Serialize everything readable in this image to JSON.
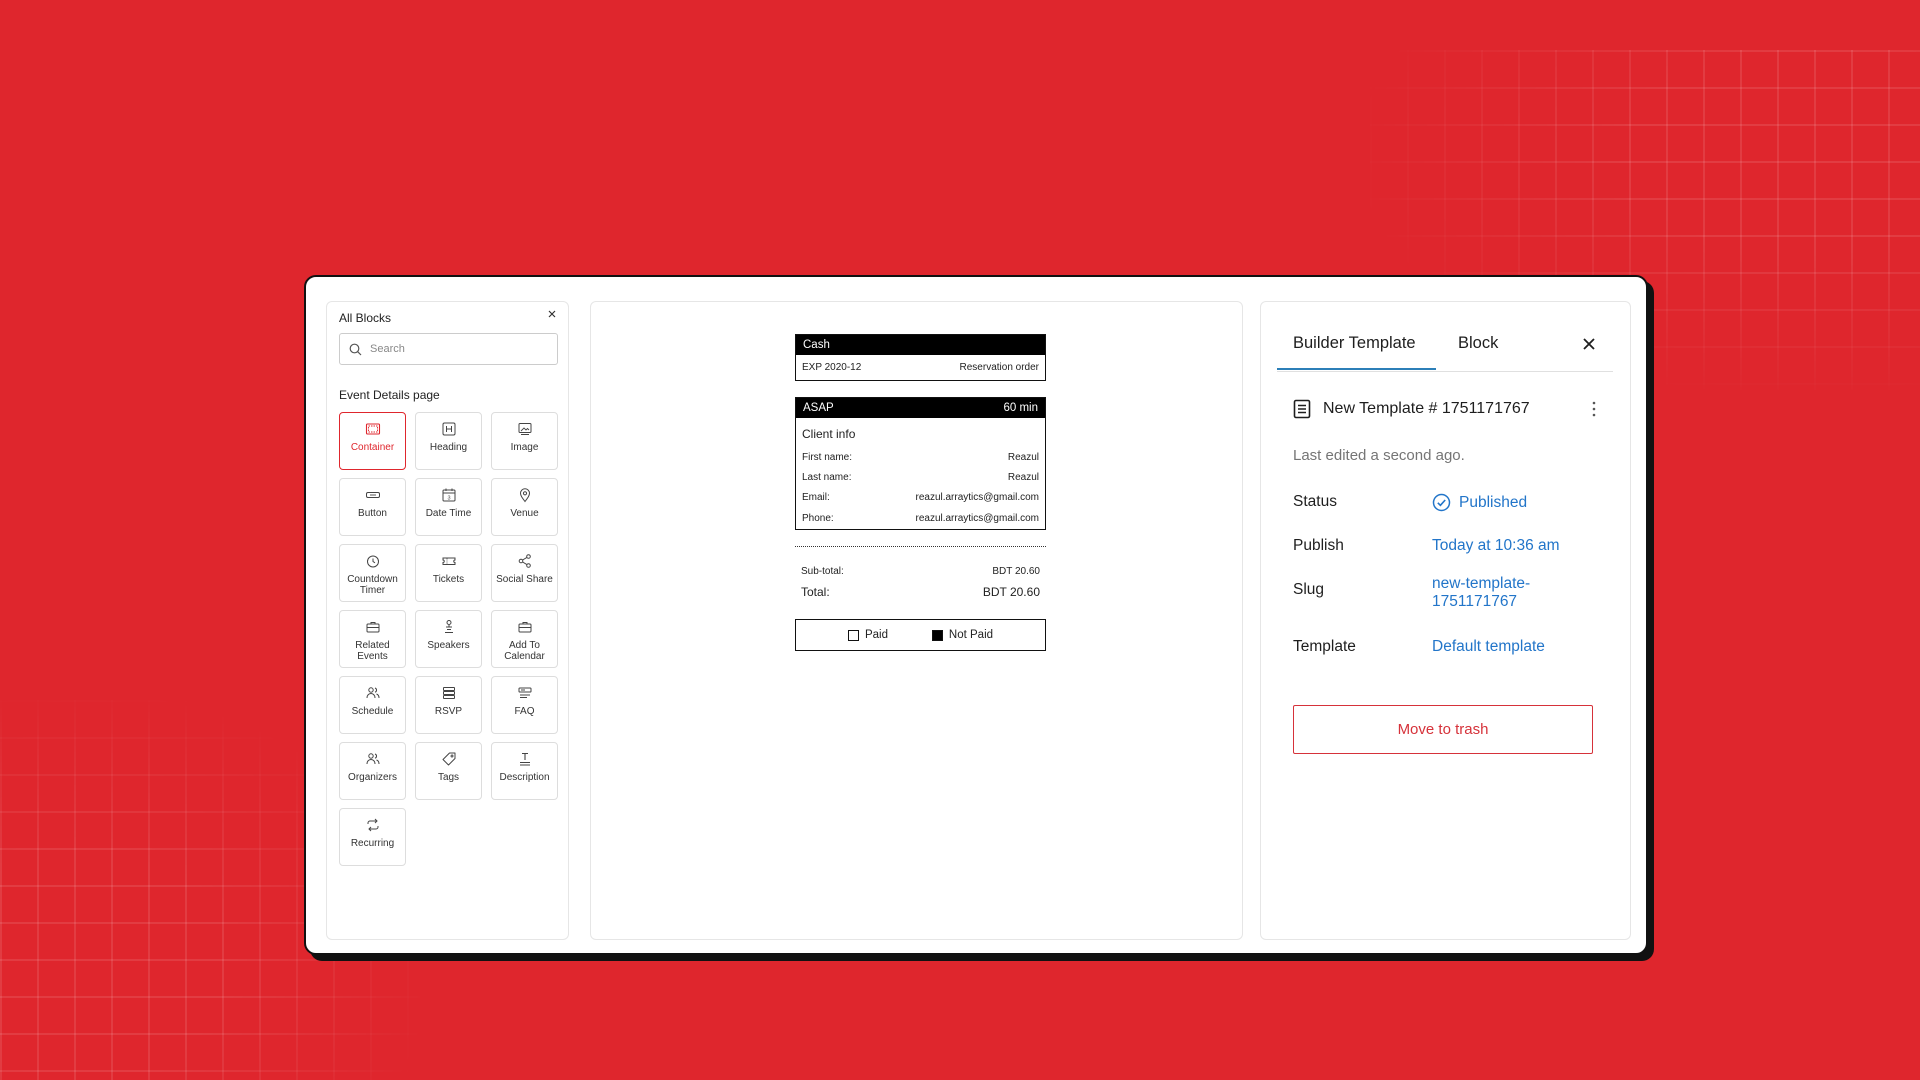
{
  "colors": {
    "background": "#df262d",
    "accent_red": "#df262d",
    "link_blue": "#2275c9",
    "tab_underline": "#2c7fb8"
  },
  "blocks_panel": {
    "title": "All Blocks",
    "search_placeholder": "Search",
    "section_label": "Event Details page",
    "tiles": [
      {
        "label": "Container",
        "icon": "container-icon",
        "active": true
      },
      {
        "label": "Heading",
        "icon": "heading-icon"
      },
      {
        "label": "Image",
        "icon": "image-icon"
      },
      {
        "label": "Button",
        "icon": "button-icon"
      },
      {
        "label": "Date Time",
        "icon": "calendar-icon"
      },
      {
        "label": "Venue",
        "icon": "map-pin-icon"
      },
      {
        "label": "Countdown Timer",
        "icon": "timer-icon"
      },
      {
        "label": "Tickets",
        "icon": "ticket-icon"
      },
      {
        "label": "Social Share",
        "icon": "share-icon"
      },
      {
        "label": "Related Events",
        "icon": "related-events-icon"
      },
      {
        "label": "Speakers",
        "icon": "speaker-icon"
      },
      {
        "label": "Add To Calendar",
        "icon": "add-calendar-icon"
      },
      {
        "label": "Schedule",
        "icon": "users-icon"
      },
      {
        "label": "RSVP",
        "icon": "list-icon"
      },
      {
        "label": "FAQ",
        "icon": "faq-icon"
      },
      {
        "label": "Organizers",
        "icon": "users-icon"
      },
      {
        "label": "Tags",
        "icon": "tag-icon"
      },
      {
        "label": "Description",
        "icon": "text-icon"
      },
      {
        "label": "Recurring",
        "icon": "repeat-icon"
      }
    ]
  },
  "receipt": {
    "payment_header": "Cash",
    "exp_label": "EXP 2020-12",
    "order_type": "Reservation order",
    "timing_left": "ASAP",
    "timing_right": "60 min",
    "client_info_title": "Client info",
    "fields": [
      {
        "key": "First name:",
        "value": "Reazul"
      },
      {
        "key": "Last name:",
        "value": "Reazul"
      },
      {
        "key": "Email:",
        "value": "reazul.arraytics@gmail.com"
      },
      {
        "key": "Phone:",
        "value": "reazul.arraytics@gmail.com"
      }
    ],
    "subtotal_label": "Sub-total:",
    "subtotal_value": "BDT 20.60",
    "total_label": "Total:",
    "total_value": "BDT 20.60",
    "paid_label": "Paid",
    "not_paid_label": "Not Paid"
  },
  "settings": {
    "tabs": [
      "Builder Template",
      "Block"
    ],
    "active_tab": "Builder Template",
    "template_title": "New Template # 1751171767",
    "last_edited": "Last edited a second ago.",
    "status_label": "Status",
    "status_value": "Published",
    "publish_label": "Publish",
    "publish_value": "Today at 10:36 am",
    "slug_label": "Slug",
    "slug_value_line1": "new-template-",
    "slug_value_line2": "1751171767",
    "template_label": "Template",
    "template_value": "Default template",
    "trash_button": "Move to trash"
  }
}
